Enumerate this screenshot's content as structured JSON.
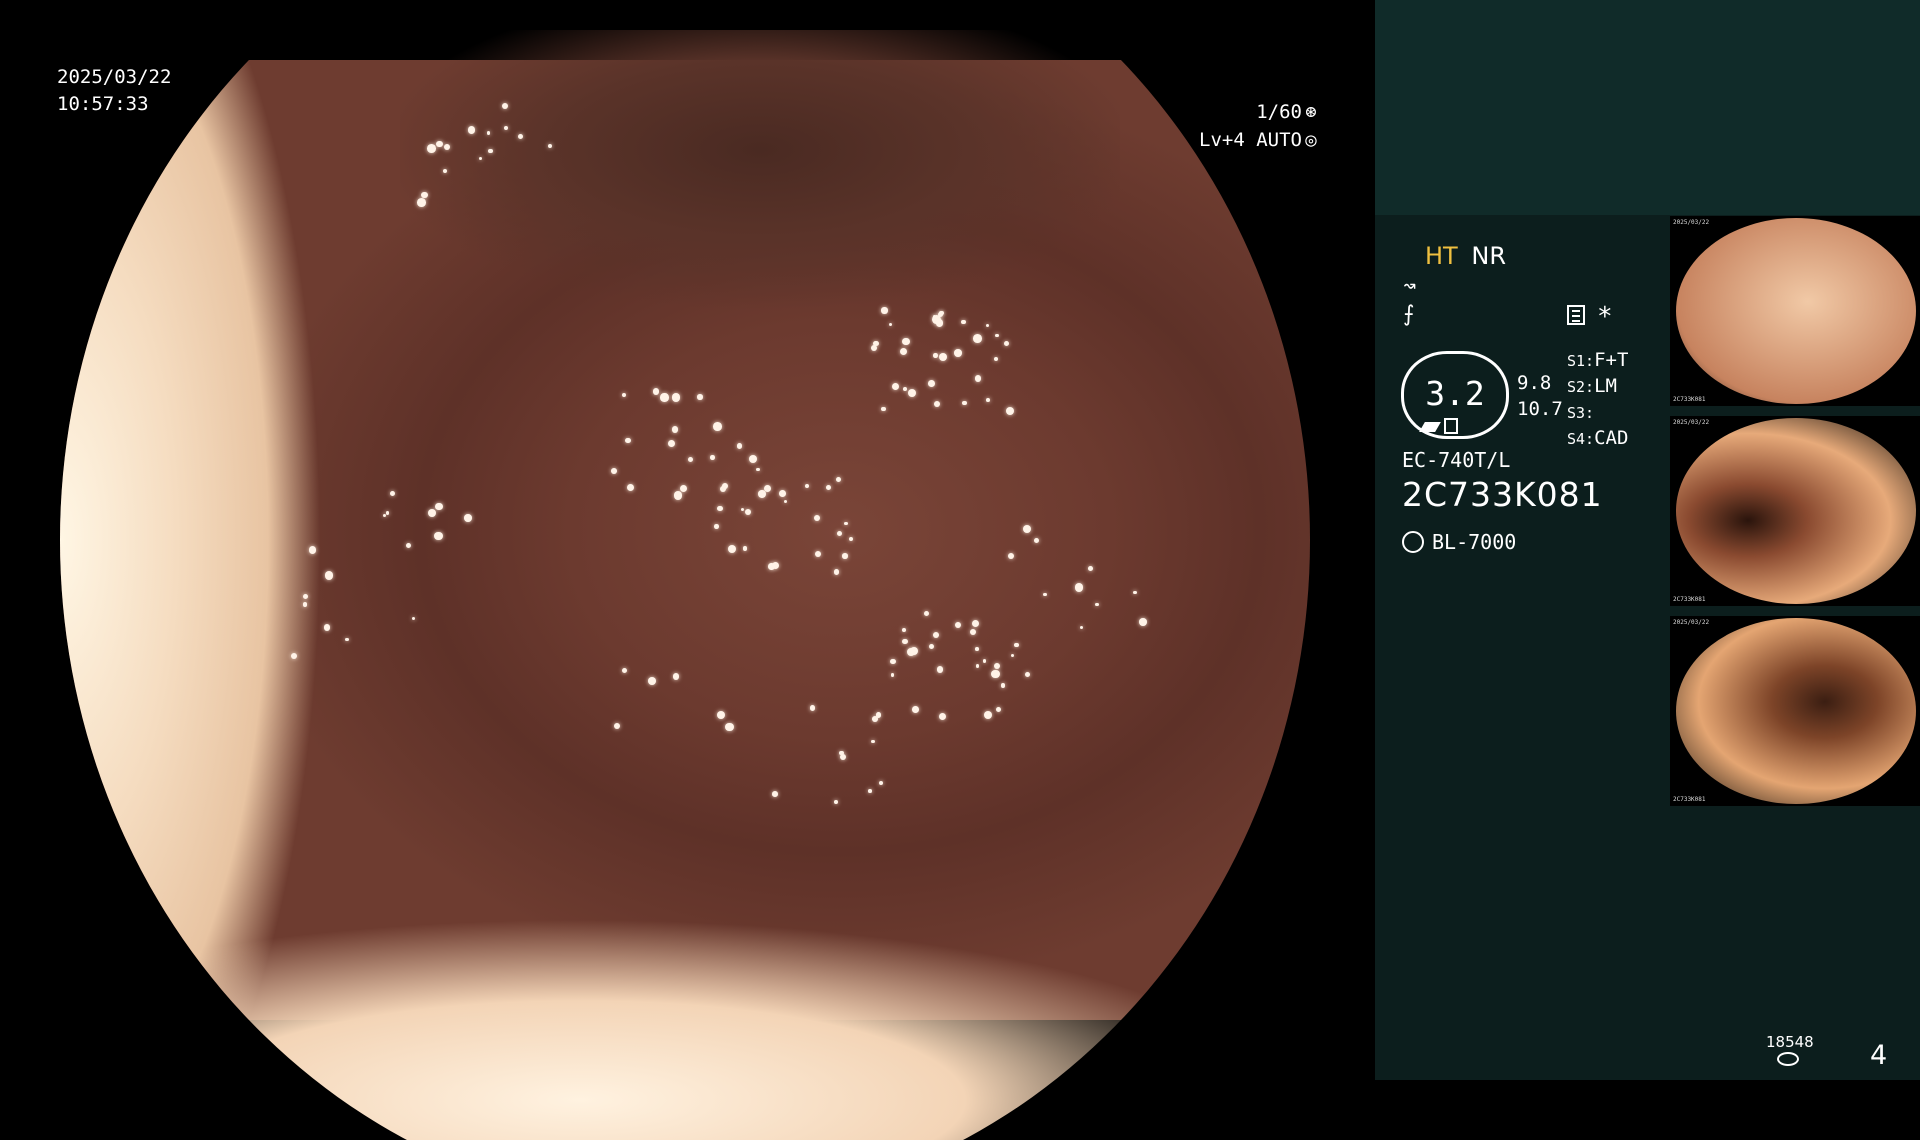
{
  "overlay": {
    "date": "2025/03/22",
    "time": "10:57:33",
    "shutter": "1/60",
    "level": "Lv+4",
    "mode": "AUTO"
  },
  "panel": {
    "ht": "HT",
    "nr": "NR",
    "zoom": "3.2",
    "range_top": "9.8",
    "range_bottom": "10.7",
    "s1_key": "S1:",
    "s1_val": "F+T",
    "s2_key": "S2:",
    "s2_val": "LM",
    "s3_key": "S3:",
    "s3_val": "",
    "s4_key": "S4:",
    "s4_val": "CAD",
    "scope_model": "EC-740T/L",
    "serial": "2C733K081",
    "light_source": "BL-7000"
  },
  "thumbnails": [
    {
      "meta": "2025/03/22",
      "foot": "2C733K081",
      "colors": [
        "#f1c9a6",
        "#c7835f"
      ]
    },
    {
      "meta": "2025/03/22",
      "foot": "2C733K081",
      "colors": [
        "#e7aa7a",
        "#8a4a30"
      ]
    },
    {
      "meta": "2025/03/22",
      "foot": "2C733K081",
      "colors": [
        "#e4a572",
        "#7d4428"
      ]
    }
  ],
  "footer": {
    "count": "18548",
    "page": "4"
  },
  "colors": {
    "panel_bg": "#0c1e1d",
    "panel_header": "#102b29",
    "ht_accent": "#f0c040"
  }
}
